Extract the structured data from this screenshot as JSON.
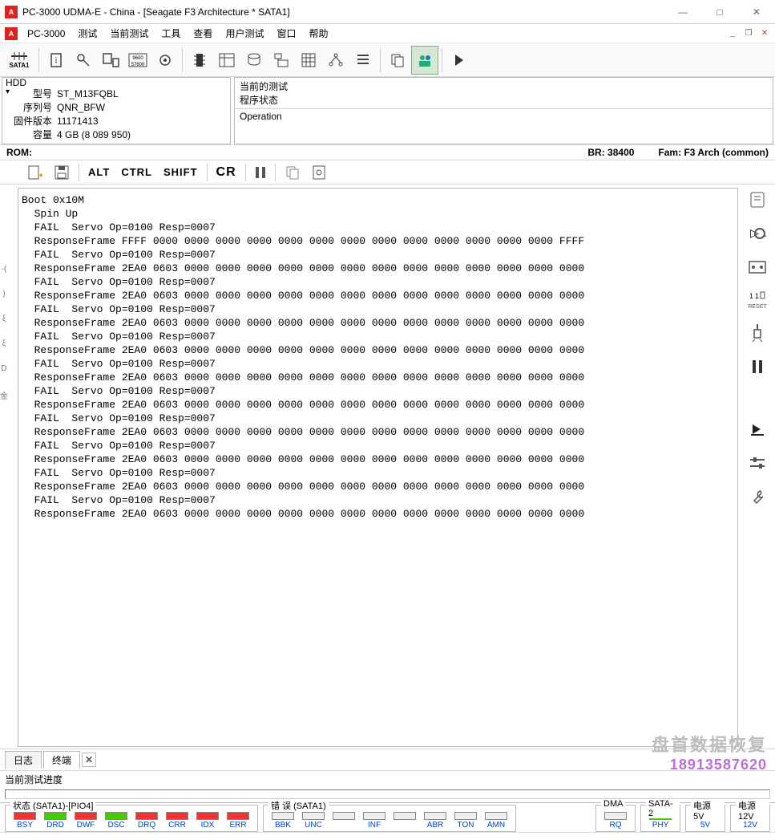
{
  "window": {
    "title": "PC-3000 UDMA-E - China - [Seagate F3 Architecture * SATA1]"
  },
  "menu": {
    "app": "PC-3000",
    "items": [
      "测试",
      "当前测试",
      "工具",
      "查看",
      "用户测试",
      "窗口",
      "帮助"
    ]
  },
  "toolbar_sata_label": "SATA1",
  "hdd": {
    "legend": "HDD",
    "model_label": "型号",
    "model": "ST_M13FQBL",
    "serial_label": "序列号",
    "serial": "QNR_BFW",
    "fw_label": "固件版本",
    "fw": "11171413",
    "cap_label": "容量",
    "cap": "4 GB (8 089 950)"
  },
  "ops": {
    "row1_label": "当前的测试",
    "row1_val": "程序状态",
    "row2_label": "Operation"
  },
  "rom": {
    "left": "ROM:",
    "br_label": "BR:",
    "br_val": "38400",
    "fam_label": "Fam:",
    "fam_val": "F3 Arch (common)"
  },
  "belt": {
    "alt": "ALT",
    "ctrl": "CTRL",
    "shift": "SHIFT",
    "cr": "CR"
  },
  "terminal_lines": [
    "Boot 0x10M",
    "  Spin Up",
    "  FAIL  Servo Op=0100 Resp=0007",
    "  ResponseFrame FFFF 0000 0000 0000 0000 0000 0000 0000 0000 0000 0000 0000 0000 0000 FFFF",
    "  FAIL  Servo Op=0100 Resp=0007",
    "  ResponseFrame 2EA0 0603 0000 0000 0000 0000 0000 0000 0000 0000 0000 0000 0000 0000 0000",
    "  FAIL  Servo Op=0100 Resp=0007",
    "  ResponseFrame 2EA0 0603 0000 0000 0000 0000 0000 0000 0000 0000 0000 0000 0000 0000 0000",
    "  FAIL  Servo Op=0100 Resp=0007",
    "  ResponseFrame 2EA0 0603 0000 0000 0000 0000 0000 0000 0000 0000 0000 0000 0000 0000 0000",
    "  FAIL  Servo Op=0100 Resp=0007",
    "  ResponseFrame 2EA0 0603 0000 0000 0000 0000 0000 0000 0000 0000 0000 0000 0000 0000 0000",
    "  FAIL  Servo Op=0100 Resp=0007",
    "  ResponseFrame 2EA0 0603 0000 0000 0000 0000 0000 0000 0000 0000 0000 0000 0000 0000 0000",
    "  FAIL  Servo Op=0100 Resp=0007",
    "  ResponseFrame 2EA0 0603 0000 0000 0000 0000 0000 0000 0000 0000 0000 0000 0000 0000 0000",
    "  FAIL  Servo Op=0100 Resp=0007",
    "  ResponseFrame 2EA0 0603 0000 0000 0000 0000 0000 0000 0000 0000 0000 0000 0000 0000 0000",
    "  FAIL  Servo Op=0100 Resp=0007",
    "  ResponseFrame 2EA0 0603 0000 0000 0000 0000 0000 0000 0000 0000 0000 0000 0000 0000 0000",
    "  FAIL  Servo Op=0100 Resp=0007",
    "  ResponseFrame 2EA0 0603 0000 0000 0000 0000 0000 0000 0000 0000 0000 0000 0000 0000 0000",
    "  FAIL  Servo Op=0100 Resp=0007",
    "  ResponseFrame 2EA0 0603 0000 0000 0000 0000 0000 0000 0000 0000 0000 0000 0000 0000 0000"
  ],
  "tabs": {
    "log": "日志",
    "term": "终端"
  },
  "progress_label": "当前测试进度",
  "watermark": {
    "line1": "盘首数据恢复",
    "line2": "18913587620"
  },
  "right_reset": "RESET",
  "status": {
    "state_legend": "状态 (SATA1)-[PIO4]",
    "state_leds": [
      {
        "t": "BSY",
        "c": "red"
      },
      {
        "t": "DRD",
        "c": "green"
      },
      {
        "t": "DWF",
        "c": "red"
      },
      {
        "t": "DSC",
        "c": "green"
      },
      {
        "t": "DRQ",
        "c": "red"
      },
      {
        "t": "CRR",
        "c": "red"
      },
      {
        "t": "IDX",
        "c": "red"
      },
      {
        "t": "ERR",
        "c": "red"
      }
    ],
    "err_legend": "错 误 (SATA1)",
    "err_leds": [
      {
        "t": "BBK",
        "c": "off"
      },
      {
        "t": "UNC",
        "c": "off"
      },
      {
        "t": "",
        "c": "off"
      },
      {
        "t": "INF",
        "c": "off"
      },
      {
        "t": "",
        "c": "off"
      },
      {
        "t": "ABR",
        "c": "off"
      },
      {
        "t": "TON",
        "c": "off"
      },
      {
        "t": "AMN",
        "c": "off"
      }
    ],
    "dma_legend": "DMA",
    "dma_led": {
      "t": "RQ",
      "c": "off"
    },
    "sata2_legend": "SATA-2",
    "sata2_led": {
      "t": "PHY",
      "c": "green"
    },
    "p5_legend": "电源 5V",
    "p5_led": {
      "t": "5V",
      "c": "green"
    },
    "p12_legend": "电源 12V",
    "p12_led": {
      "t": "12V",
      "c": "green"
    }
  }
}
